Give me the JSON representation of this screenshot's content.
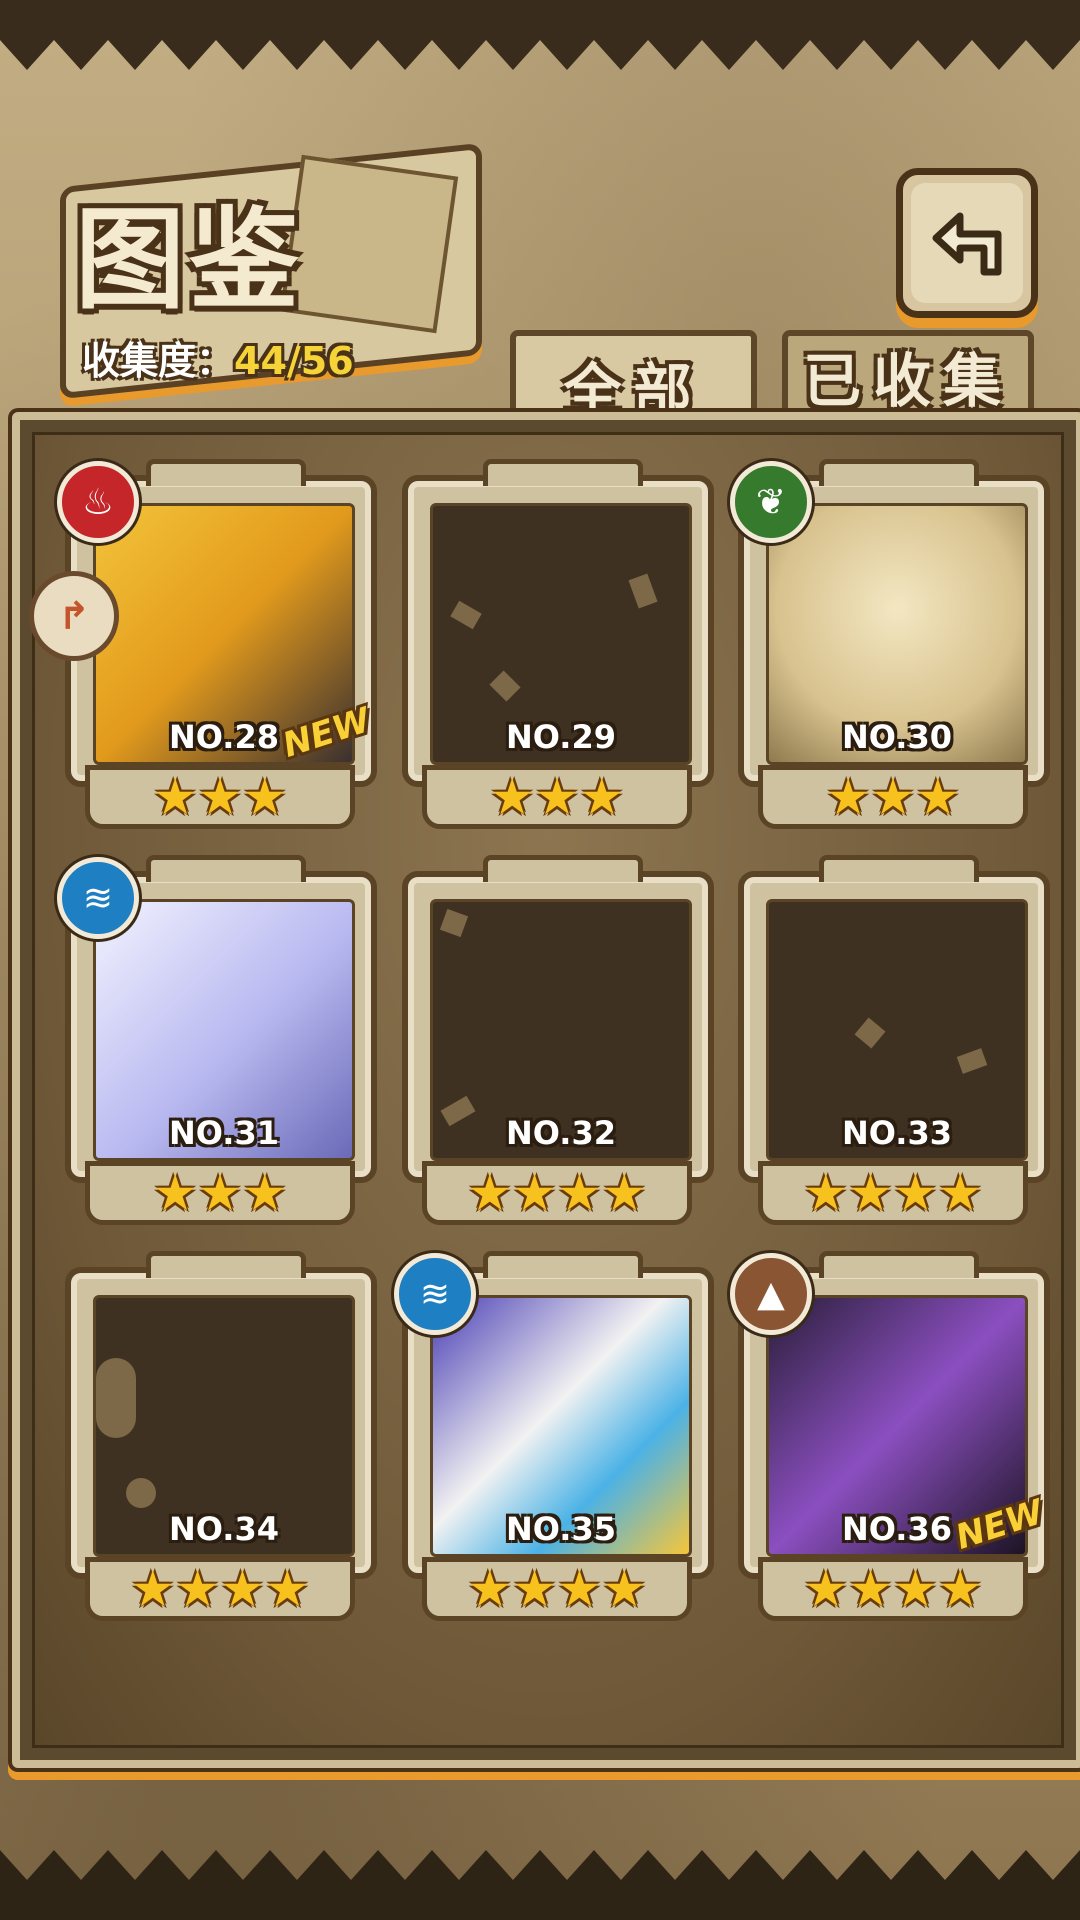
{
  "header": {
    "title": "图鉴",
    "progress_label": "收集度：",
    "progress_value": "44/56"
  },
  "tabs": [
    {
      "label": "全部",
      "active": true
    },
    {
      "label": "已收集",
      "active": false
    }
  ],
  "cards": [
    {
      "number": "NO.28",
      "stars": "★★★",
      "element": "fire-icon",
      "collected": true,
      "new": true,
      "badge": "NEW"
    },
    {
      "number": "NO.29",
      "stars": "★★★",
      "collected": false
    },
    {
      "number": "NO.30",
      "stars": "★★★",
      "element": "leaf-icon",
      "collected": true
    },
    {
      "number": "NO.31",
      "stars": "★★★",
      "element": "water-icon",
      "collected": true
    },
    {
      "number": "NO.32",
      "stars": "★★★★",
      "collected": false
    },
    {
      "number": "NO.33",
      "stars": "★★★★",
      "collected": false
    },
    {
      "number": "NO.34",
      "stars": "★★★★",
      "collected": false
    },
    {
      "number": "NO.35",
      "stars": "★★★★",
      "element": "water-icon",
      "collected": true
    },
    {
      "number": "NO.36",
      "stars": "★★★★",
      "element": "earth-icon",
      "collected": true,
      "new": true,
      "badge": "NEW"
    }
  ],
  "colors": {
    "accent": "#e89a2c",
    "star": "#f7c21d",
    "fire": "#c4262a",
    "wind": "#357a2d",
    "water": "#1e7fc2",
    "earth": "#8a5533"
  }
}
